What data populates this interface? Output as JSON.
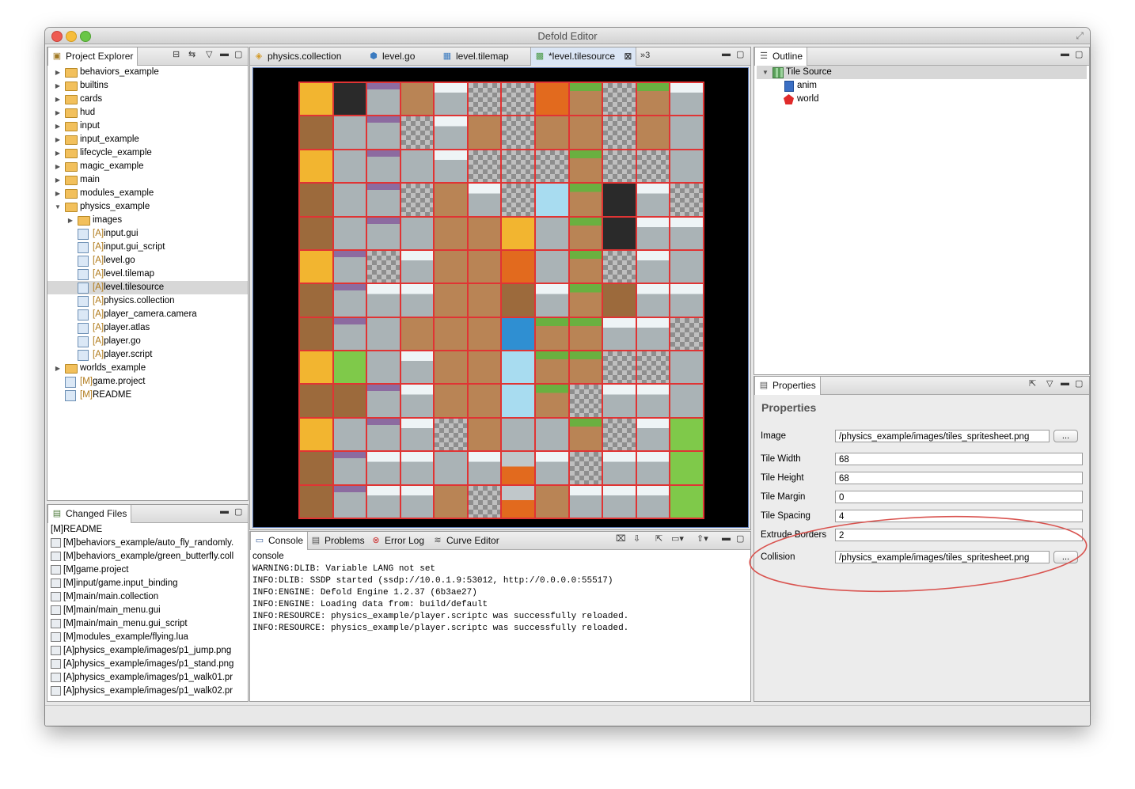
{
  "window": {
    "title": "Defold Editor"
  },
  "project_explorer": {
    "tab": "Project Explorer",
    "items": [
      {
        "label": "behaviors_example",
        "prefix": "",
        "depth": 0,
        "kind": "folder",
        "arrow": "▶"
      },
      {
        "label": "builtins",
        "prefix": "",
        "depth": 0,
        "kind": "folder",
        "arrow": "▶"
      },
      {
        "label": "cards",
        "prefix": "",
        "depth": 0,
        "kind": "folder",
        "arrow": "▶"
      },
      {
        "label": "hud",
        "prefix": "",
        "depth": 0,
        "kind": "folder",
        "arrow": "▶"
      },
      {
        "label": "input",
        "prefix": "",
        "depth": 0,
        "kind": "folder",
        "arrow": "▶"
      },
      {
        "label": "input_example",
        "prefix": "",
        "depth": 0,
        "kind": "folder",
        "arrow": "▶"
      },
      {
        "label": "lifecycle_example",
        "prefix": "",
        "depth": 0,
        "kind": "folder",
        "arrow": "▶"
      },
      {
        "label": "magic_example",
        "prefix": "",
        "depth": 0,
        "kind": "folder",
        "arrow": "▶"
      },
      {
        "label": "main",
        "prefix": "",
        "depth": 0,
        "kind": "folder",
        "arrow": "▶"
      },
      {
        "label": "modules_example",
        "prefix": "",
        "depth": 0,
        "kind": "folder",
        "arrow": "▶"
      },
      {
        "label": "physics_example",
        "prefix": "",
        "depth": 0,
        "kind": "folder",
        "arrow": "▼"
      },
      {
        "label": "images",
        "prefix": "",
        "depth": 1,
        "kind": "folder",
        "arrow": "▶"
      },
      {
        "label": "input.gui",
        "prefix": "[A]",
        "depth": 1,
        "kind": "file",
        "arrow": ""
      },
      {
        "label": "input.gui_script",
        "prefix": "[A]",
        "depth": 1,
        "kind": "file",
        "arrow": ""
      },
      {
        "label": "level.go",
        "prefix": "[A]",
        "depth": 1,
        "kind": "file",
        "arrow": ""
      },
      {
        "label": "level.tilemap",
        "prefix": "[A]",
        "depth": 1,
        "kind": "file",
        "arrow": ""
      },
      {
        "label": "level.tilesource",
        "prefix": "[A]",
        "depth": 1,
        "kind": "file",
        "arrow": "",
        "selected": true
      },
      {
        "label": "physics.collection",
        "prefix": "[A]",
        "depth": 1,
        "kind": "file",
        "arrow": ""
      },
      {
        "label": "player_camera.camera",
        "prefix": "[A]",
        "depth": 1,
        "kind": "file",
        "arrow": ""
      },
      {
        "label": "player.atlas",
        "prefix": "[A]",
        "depth": 1,
        "kind": "file",
        "arrow": ""
      },
      {
        "label": "player.go",
        "prefix": "[A]",
        "depth": 1,
        "kind": "file",
        "arrow": ""
      },
      {
        "label": "player.script",
        "prefix": "[A]",
        "depth": 1,
        "kind": "file",
        "arrow": ""
      },
      {
        "label": "worlds_example",
        "prefix": "",
        "depth": 0,
        "kind": "folder",
        "arrow": "▶"
      },
      {
        "label": "game.project",
        "prefix": "[M]",
        "depth": 0,
        "kind": "file",
        "arrow": ""
      },
      {
        "label": "README",
        "prefix": "[M]",
        "depth": 0,
        "kind": "file",
        "arrow": ""
      }
    ]
  },
  "changed_files": {
    "tab": "Changed Files",
    "items": [
      "[M]README",
      "[M]behaviors_example/auto_fly_randomly.",
      "[M]behaviors_example/green_butterfly.coll",
      "[M]game.project",
      "[M]input/game.input_binding",
      "[M]main/main.collection",
      "[M]main/main_menu.gui",
      "[M]main/main_menu.gui_script",
      "[M]modules_example/flying.lua",
      "[A]physics_example/images/p1_jump.png",
      "[A]physics_example/images/p1_stand.png",
      "[A]physics_example/images/p1_walk01.pr",
      "[A]physics_example/images/p1_walk02.pr"
    ]
  },
  "editor": {
    "tabs": [
      "physics.collection",
      "level.go",
      "level.tilemap",
      "*level.tilesource"
    ],
    "overflow": "»3",
    "close_glyph": "⊠",
    "tiles": [
      "c-box",
      "c-dark",
      "c-purple",
      "c-dirt",
      "c-snow",
      "c-check",
      "c-check",
      "c-orange",
      "c-grass",
      "c-check",
      "c-grass",
      "c-snow",
      "c-brown",
      "c-stone",
      "c-purple",
      "c-check",
      "c-snow",
      "c-dirt",
      "c-check",
      "c-dirt",
      "c-dirt",
      "c-check",
      "c-dirt",
      "c-stone",
      "c-box",
      "c-stone",
      "c-purple",
      "c-stone",
      "c-snow",
      "c-check",
      "c-check",
      "c-check",
      "c-grass",
      "c-check",
      "c-check",
      "c-stone",
      "c-brown",
      "c-stone",
      "c-purple",
      "c-check",
      "c-dirt",
      "c-snow",
      "c-check",
      "c-water",
      "c-grass",
      "c-dark",
      "c-snow",
      "c-check",
      "c-brown",
      "c-stone",
      "c-purple",
      "c-stone",
      "c-dirt",
      "c-dirt",
      "c-box",
      "c-stone",
      "c-grass",
      "c-dark",
      "c-snow",
      "c-snow",
      "c-box",
      "c-purple",
      "c-check",
      "c-snow",
      "c-dirt",
      "c-dirt",
      "c-orange",
      "c-stone",
      "c-grass",
      "c-check",
      "c-snow",
      "c-stone",
      "c-brown",
      "c-purple",
      "c-snow",
      "c-snow",
      "c-dirt",
      "c-dirt",
      "c-brown",
      "c-snow",
      "c-grass",
      "c-brown",
      "c-snow",
      "c-snow",
      "c-brown",
      "c-purple",
      "c-stone",
      "c-dirt",
      "c-dirt",
      "c-dirt",
      "c-blue",
      "c-grass",
      "c-grass",
      "c-snow",
      "c-snow",
      "c-check",
      "c-box",
      "c-green",
      "c-stone",
      "c-snow",
      "c-dirt",
      "c-dirt",
      "c-water",
      "c-grass",
      "c-grass",
      "c-check",
      "c-check",
      "c-stone",
      "c-brown",
      "c-brown",
      "c-purple",
      "c-snow",
      "c-dirt",
      "c-dirt",
      "c-water",
      "c-grass",
      "c-check",
      "c-snow",
      "c-snow",
      "c-stone",
      "c-box",
      "c-stone",
      "c-purple",
      "c-snow",
      "c-check",
      "c-dirt",
      "c-stone",
      "c-stone",
      "c-grass",
      "c-check",
      "c-snow",
      "c-green",
      "c-brown",
      "c-purple",
      "c-snow",
      "c-snow",
      "c-stone",
      "c-snow",
      "c-lava",
      "c-snow",
      "c-check",
      "c-snow",
      "c-snow",
      "c-green",
      "c-brown",
      "c-purple",
      "c-snow",
      "c-snow",
      "c-dirt",
      "c-check",
      "c-lava",
      "c-dirt",
      "c-snow",
      "c-snow",
      "c-snow",
      "c-green"
    ]
  },
  "console": {
    "tabs": [
      "Console",
      "Problems",
      "Error Log",
      "Curve Editor"
    ],
    "header": "console",
    "lines": [
      "WARNING:DLIB: Variable LANG not set",
      "INFO:DLIB: SSDP started (ssdp://10.0.1.9:53012, http://0.0.0.0:55517)",
      "INFO:ENGINE: Defold Engine 1.2.37 (6b3ae27)",
      "INFO:ENGINE: Loading data from: build/default",
      "INFO:RESOURCE: physics_example/player.scriptc was successfully reloaded.",
      "INFO:RESOURCE: physics_example/player.scriptc was successfully reloaded."
    ]
  },
  "outline": {
    "tab": "Outline",
    "root": "Tile Source",
    "children": [
      "anim",
      "world"
    ]
  },
  "properties": {
    "tab": "Properties",
    "heading": "Properties",
    "browse": "...",
    "rows": [
      {
        "label": "Image",
        "value": "/physics_example/images/tiles_spritesheet.png",
        "button": true
      },
      {
        "label": "Tile Width",
        "value": "68",
        "button": false
      },
      {
        "label": "Tile Height",
        "value": "68",
        "button": false
      },
      {
        "label": "Tile Margin",
        "value": "0",
        "button": false
      },
      {
        "label": "Tile Spacing",
        "value": "4",
        "button": false
      },
      {
        "label": "Extrude Borders",
        "value": "2",
        "button": false
      },
      {
        "label": "Collision",
        "value": "/physics_example/images/tiles_spritesheet.png",
        "button": true
      }
    ]
  },
  "colors": {
    "annotation": "#d9534f",
    "tile_outline": "#e03434",
    "selection": "#d7d7d7"
  }
}
